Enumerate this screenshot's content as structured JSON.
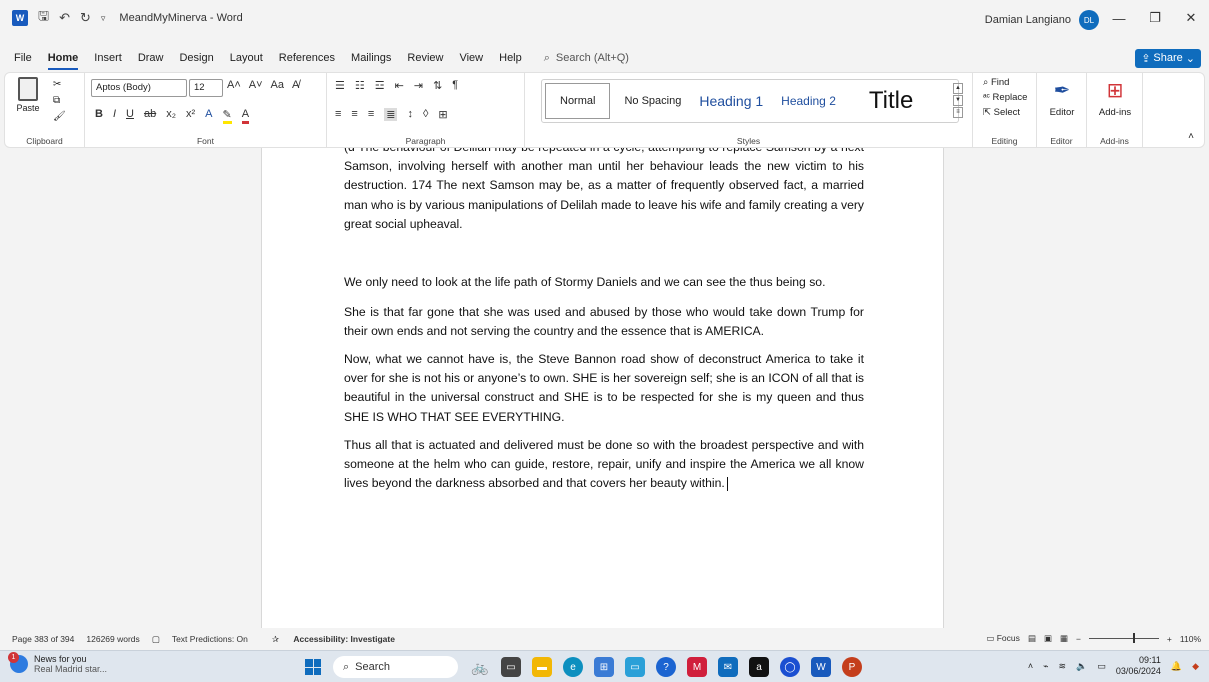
{
  "titlebar": {
    "app_icon": "W",
    "doc_title": "MeandMyMinerva - Word",
    "user_name": "Damian Langiano",
    "user_initials": "DL"
  },
  "menu": {
    "tabs": [
      "File",
      "Home",
      "Insert",
      "Draw",
      "Design",
      "Layout",
      "References",
      "Mailings",
      "Review",
      "View",
      "Help"
    ],
    "search_placeholder": "Search (Alt+Q)",
    "share_label": "Share"
  },
  "ribbon": {
    "clipboard": {
      "paste_label": "Paste",
      "group_label": "Clipboard"
    },
    "font": {
      "font_name": "Aptos (Body)",
      "font_size": "12",
      "group_label": "Font"
    },
    "paragraph": {
      "group_label": "Paragraph"
    },
    "styles": {
      "items": [
        "Normal",
        "No Spacing",
        "Heading 1",
        "Heading 2",
        "Title"
      ],
      "group_label": "Styles"
    },
    "editing": {
      "find": "Find",
      "replace": "Replace",
      "select": "Select",
      "group_label": "Editing"
    },
    "editor": {
      "label": "Editor",
      "group_label": "Editor"
    },
    "addins": {
      "label": "Add-ins",
      "group_label": "Add-ins"
    }
  },
  "document": {
    "para0": "(d The behaviour of Delilah may be repeated in a cycle, attempting to replace Samson by a next Samson, involving herself with another man until her behaviour leads the new victim to his destruction. 174 The next Samson may be, as a matter of frequently observed fact, a married man who is by various manipulations of Delilah made to leave his wife and family creating a very great social upheaval.",
    "para1": "We only need to look at the life path of Stormy Daniels and we can see the thus being so.",
    "para2": "She is that far gone that she was used and abused by those who would take down Trump for their own ends and not serving the country and the essence that is AMERICA.",
    "para3": "Now, what we cannot have is, the Steve Bannon road show of deconstruct America to take it over for she is not his or anyone’s to own. SHE is her sovereign self; she is an ICON of all that is beautiful in the universal construct and SHE is to be respected for she is my queen and thus SHE IS WHO THAT SEE EVERYTHING.",
    "para4": "Thus all that is actuated and delivered must be done so with the broadest perspective and with someone at the helm who can guide, restore, repair, unify and inspire the America we all know lives beyond the darkness absorbed and that covers her beauty within."
  },
  "status": {
    "page": "Page 383 of 394",
    "words": "126269 words",
    "predictions": "Text Predictions: On",
    "accessibility": "Accessibility: Investigate",
    "focus": "Focus",
    "zoom": "110%"
  },
  "taskbar": {
    "news_title": "News for you",
    "news_sub": "Real Madrid star...",
    "news_badge": "1",
    "search_label": "Search",
    "time": "09:11",
    "date": "03/06/2024"
  }
}
